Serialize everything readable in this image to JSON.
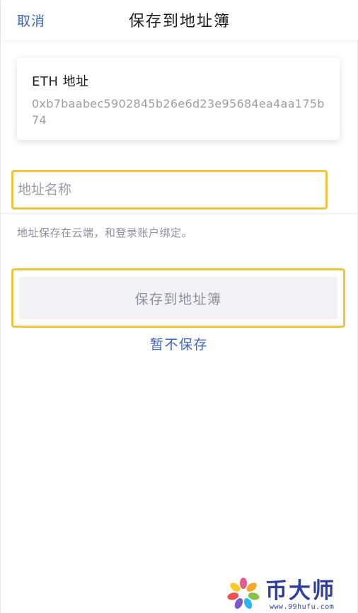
{
  "header": {
    "cancel_label": "取消",
    "title": "保存到地址簿"
  },
  "address_card": {
    "label": "ETH 地址",
    "value": "0xb7baabec5902845b26e6d23e95684ea4aa175b74"
  },
  "name_field": {
    "placeholder": "地址名称",
    "value": ""
  },
  "hint": "地址保存在云端，和登录账户绑定。",
  "save_button_label": "保存到地址簿",
  "not_save_label": "暂不保存",
  "watermark": {
    "brand": "币大师",
    "url": "www.99hufu.com"
  },
  "colors": {
    "accent_blue": "#3d63c8",
    "highlight_yellow": "#f2c43a",
    "button_bg": "#f1f2f6",
    "muted_text": "#8d919b"
  }
}
